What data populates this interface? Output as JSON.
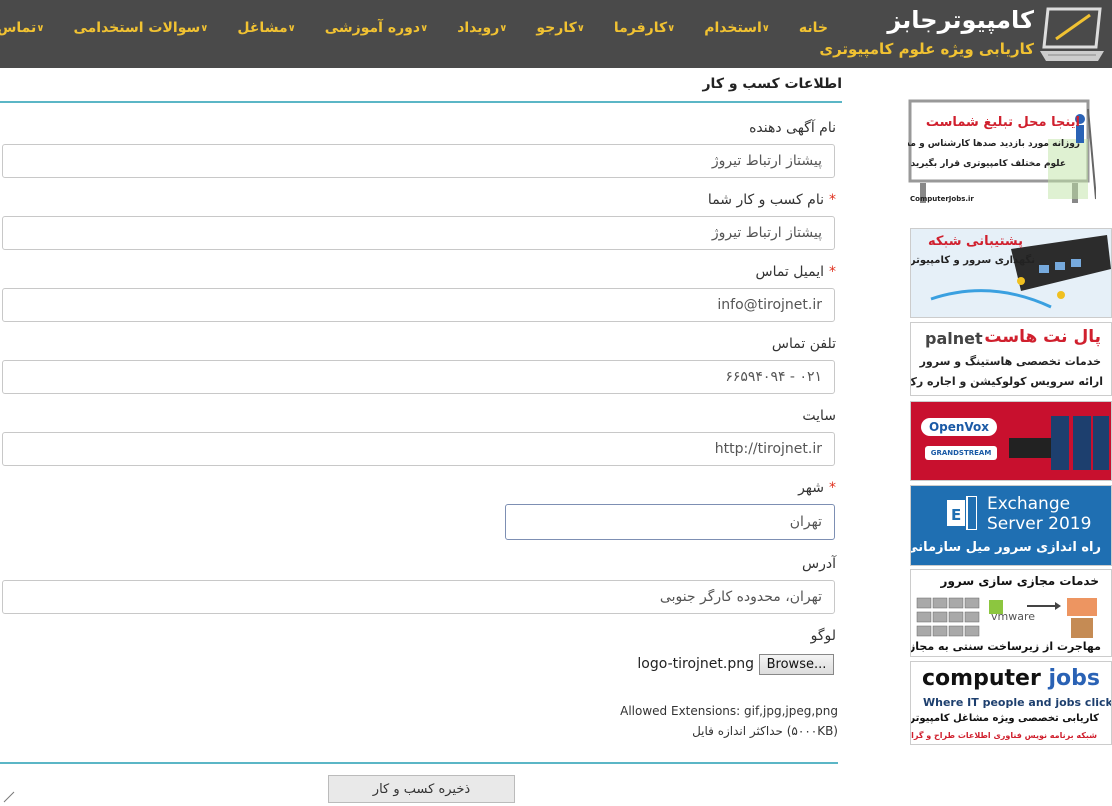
{
  "site": {
    "title": "کامپیوترجابز",
    "subtitle": "کاریابی ویژه علوم کامپیوتری"
  },
  "nav": {
    "items": [
      {
        "label": "خانه",
        "chevron": false
      },
      {
        "label": "استخدام",
        "chevron": true
      },
      {
        "label": "کارفرما",
        "chevron": true
      },
      {
        "label": "کارجو",
        "chevron": true
      },
      {
        "label": "رویداد",
        "chevron": true
      },
      {
        "label": "دوره آموزشی",
        "chevron": true
      },
      {
        "label": "مشاغل",
        "chevron": true
      },
      {
        "label": "سوالات استخدامی",
        "chevron": true
      },
      {
        "label": "تماس با ما",
        "chevron": true
      }
    ]
  },
  "form": {
    "section_title": "اطلاعات کسب و کار",
    "required_mark": "*",
    "advertiser_name": {
      "label": "نام آگهی دهنده",
      "value": "پیشتاز ارتباط تیروژ"
    },
    "business_name": {
      "label": "نام کسب و کار شما",
      "value": "پیشتاز ارتباط تیروژ"
    },
    "email": {
      "label": "ایمیل تماس",
      "value": "info@tirojnet.ir"
    },
    "phone": {
      "label": "تلفن تماس",
      "value": "۰۲۱ - ۶۶۵۹۴۰۹۴"
    },
    "website": {
      "label": "سایت",
      "value": "http://tirojnet.ir"
    },
    "city": {
      "label": "شهر",
      "value": "تهران"
    },
    "address": {
      "label": "آدرس",
      "value": "تهران، محدوده کارگر جنوبی"
    },
    "logo": {
      "label": "لوگو",
      "browse_label": "Browse...",
      "file_name": "logo-tirojnet.png",
      "allowed": "Allowed Extensions: gif,jpg,jpeg,png",
      "max_size": "حداکثر اندازه فایل (۵۰۰۰KB)"
    },
    "save_label": "ذخیره کسب و کار"
  },
  "ads": {
    "ad1": {
      "headline": "اینجا محل تبلیغ شماست",
      "line1": "روزانه مورد بازدید صدها کارشناس و مدیر",
      "line2": "علوم مختلف کامپیوتری قرار بگیرید",
      "footer": "ComputerJobs.ir"
    },
    "ad2": {
      "headline": "پشتیبانی شبکه",
      "line1": "نگهداری سرور و کامپیوتر"
    },
    "ad3": {
      "brand": "palnet",
      "headline": "پال نت هاست",
      "line1": "خدمات تخصصی هاستینگ و سرور",
      "line2": "ارائه سرویس کولوکیشن و اجاره رک"
    },
    "ad4": {
      "brand1": "OpenVox",
      "brand2": "GRANDSTREAM"
    },
    "ad5": {
      "line1": "Exchange",
      "line2": "Server 2019",
      "line3": "راه اندازی سرور میل سازمانی"
    },
    "ad6": {
      "headline": "خدمات مجازی سازی سرور",
      "brand": "vmware",
      "line1": "مهاجرت از زیرساخت سنتی به مجازی"
    },
    "ad7": {
      "brand1": "computer",
      "brand2": "jobs",
      "tagline": "Where IT people and jobs click",
      "line1": "کاریابی تخصصی ویژه مشاغل کامپیوتری",
      "line2": "شبکه برنامه نویس فناوری اطلاعات طراح و گرافیست"
    }
  },
  "colors": {
    "topbar": "#4a4a4a",
    "nav_text": "#f1c232",
    "accent_line": "#5bb6c6",
    "required": "#e0301e"
  }
}
